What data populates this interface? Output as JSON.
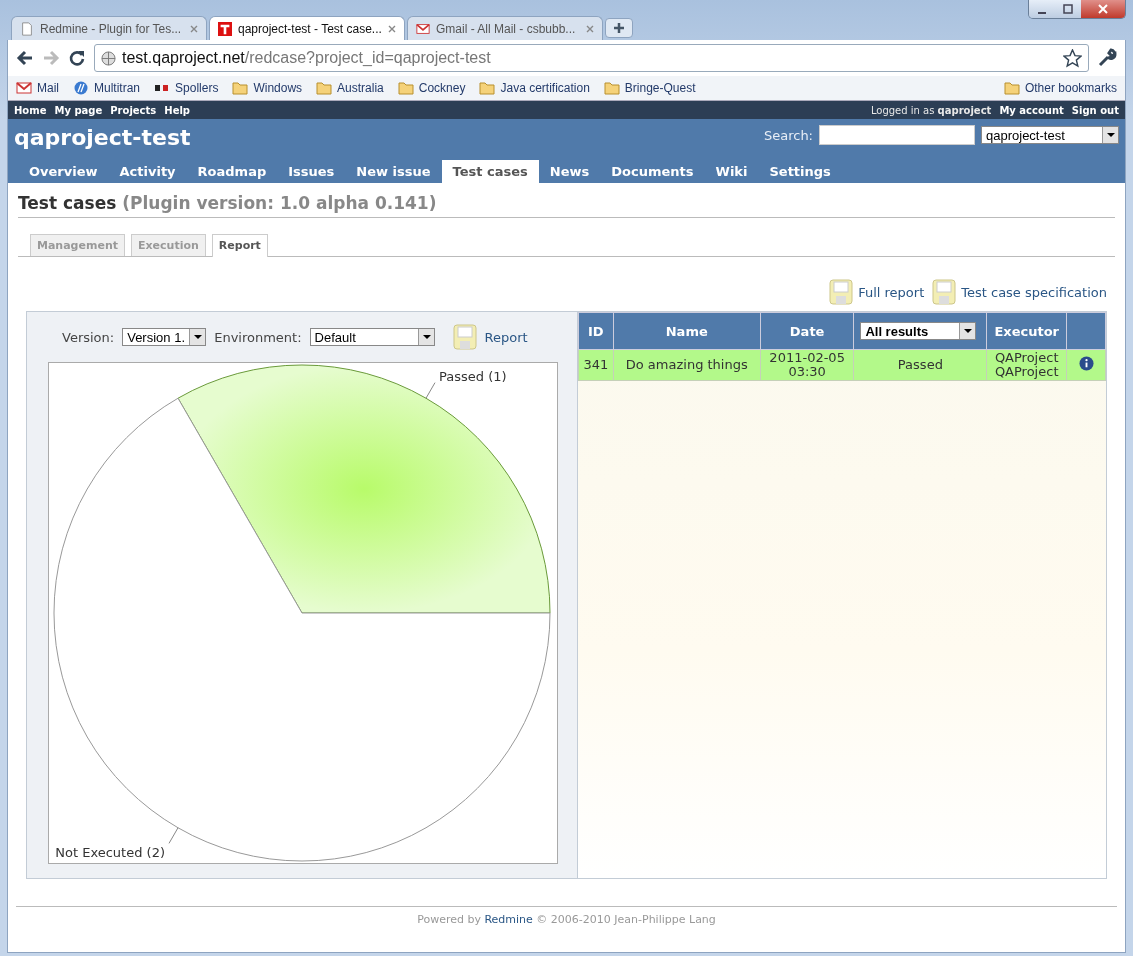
{
  "browser": {
    "tabs": [
      {
        "title": "Redmine - Plugin for Tes...",
        "kind": "page",
        "selected": false
      },
      {
        "title": "qaproject-test - Test case...",
        "kind": "t",
        "selected": true
      },
      {
        "title": "Gmail - All Mail - csbubb...",
        "kind": "gmail",
        "selected": false
      }
    ],
    "url_host": "test.qaproject.net",
    "url_path": "/redcase?project_id=qaproject-test",
    "bookmarks": [
      {
        "label": "Mail",
        "kind": "gmail"
      },
      {
        "label": "Multitran",
        "kind": "globe"
      },
      {
        "label": "Spollers",
        "kind": "sp"
      },
      {
        "label": "Windows",
        "kind": "folder"
      },
      {
        "label": "Australia",
        "kind": "folder"
      },
      {
        "label": "Cockney",
        "kind": "folder"
      },
      {
        "label": "Java certification",
        "kind": "folder"
      },
      {
        "label": "Bringe-Quest",
        "kind": "folder"
      }
    ],
    "other_bookmarks": "Other bookmarks"
  },
  "top_menu": {
    "left": [
      "Home",
      "My page",
      "Projects",
      "Help"
    ],
    "logged_in_prefix": "Logged in as",
    "user": "qaproject",
    "right": [
      "My account",
      "Sign out"
    ]
  },
  "project": {
    "title": "qaproject-test",
    "search_label": "Search:",
    "project_select": "qaproject-test"
  },
  "main_menu": [
    {
      "label": "Overview",
      "selected": false
    },
    {
      "label": "Activity",
      "selected": false
    },
    {
      "label": "Roadmap",
      "selected": false
    },
    {
      "label": "Issues",
      "selected": false
    },
    {
      "label": "New issue",
      "selected": false
    },
    {
      "label": "Test cases",
      "selected": true
    },
    {
      "label": "News",
      "selected": false
    },
    {
      "label": "Documents",
      "selected": false
    },
    {
      "label": "Wiki",
      "selected": false
    },
    {
      "label": "Settings",
      "selected": false
    }
  ],
  "heading": {
    "title": "Test cases",
    "version": "(Plugin version: 1.0 alpha 0.141)"
  },
  "sub_tabs": [
    {
      "label": "Management",
      "selected": false
    },
    {
      "label": "Execution",
      "selected": false
    },
    {
      "label": "Report",
      "selected": true
    }
  ],
  "report_links": [
    "Full report",
    "Test case specification"
  ],
  "filters": {
    "version_label": "Version:",
    "version": "Version 1.",
    "environment_label": "Environment:",
    "environment": "Default",
    "report_link": "Report"
  },
  "chart_data": {
    "type": "pie",
    "categories": [
      "Passed (1)",
      "Not Executed (2)"
    ],
    "values": [
      1,
      2
    ]
  },
  "table": {
    "columns": [
      "ID",
      "Name",
      "Date"
    ],
    "result_filter": "All results",
    "executor_column": "Executor",
    "rows": [
      {
        "id": "341",
        "name": "Do amazing things",
        "date": [
          "2011-02-05",
          "03:30"
        ],
        "result": "Passed",
        "executor": [
          "QAProject",
          "QAProject"
        ]
      }
    ]
  },
  "footer": {
    "before": "Powered by",
    "link": "Redmine",
    "after": "© 2006-2010 Jean-Philippe Lang"
  }
}
